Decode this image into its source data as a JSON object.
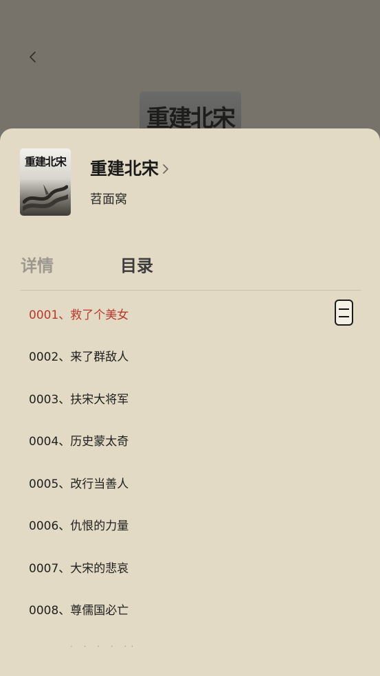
{
  "background": {
    "back_icon": "chevron-left-icon",
    "cover_title": "重建北宋"
  },
  "book": {
    "thumb_title": "重建北宋",
    "title": "重建北宋",
    "title_icon": "chevron-right-icon",
    "author": "苕面窝"
  },
  "tabs": {
    "details": "详情",
    "catalog": "目录",
    "active": "catalog"
  },
  "chapters": [
    "0001、救了个美女",
    "0002、来了群敌人",
    "0003、扶宋大将军",
    "0004、历史蒙太奇",
    "0005、改行当善人",
    "0006、仇恨的力量",
    "0007、大宋的悲哀",
    "0008、尊儒国必亡"
  ],
  "active_chapter_index": 0,
  "colors": {
    "overlay": "#77736a",
    "sheet": "#e2dac4",
    "active_chapter": "#b8392c"
  }
}
